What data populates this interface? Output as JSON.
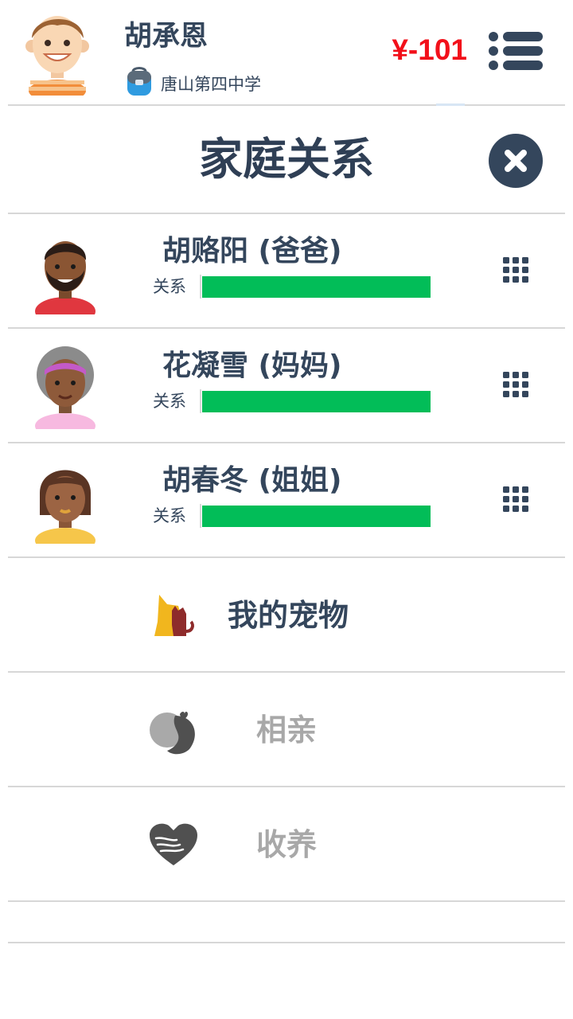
{
  "player": {
    "name": "胡承恩",
    "school": "唐山第四中学",
    "money": "¥-101"
  },
  "panel": {
    "title": "家庭关系"
  },
  "family": [
    {
      "name": "胡赂阳 (爸爸)",
      "relation_label": "关系",
      "relation_level": 1.0
    },
    {
      "name": "花凝雪 (妈妈)",
      "relation_label": "关系",
      "relation_level": 1.0
    },
    {
      "name": "胡春冬 (姐姐)",
      "relation_label": "关系",
      "relation_level": 1.0
    }
  ],
  "actions": [
    {
      "label": "我的宠物",
      "enabled": true,
      "icon": "pet-icon"
    },
    {
      "label": "相亲",
      "enabled": false,
      "icon": "dating-icon"
    },
    {
      "label": "收养",
      "enabled": false,
      "icon": "adopt-icon"
    }
  ],
  "colors": {
    "primary": "#34465c",
    "money": "#f2101a",
    "relation_bar": "#02bd58",
    "disabled_text": "#a8a8a8"
  }
}
